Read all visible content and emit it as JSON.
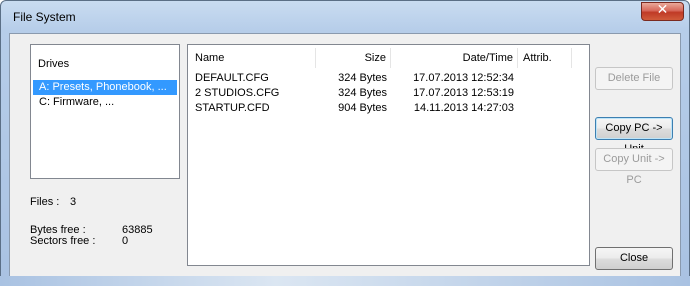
{
  "window": {
    "title": "File System",
    "close_glyph": "✕"
  },
  "drives": {
    "header": "Drives",
    "items": [
      "A: Presets, Phonebook, ...",
      "C: Firmware, ..."
    ]
  },
  "stats": {
    "files_label": "Files :",
    "files_value": "3",
    "bytes_free_label": "Bytes free :",
    "bytes_free_value": "63885",
    "sectors_free_label": "Sectors free :",
    "sectors_free_value": "0"
  },
  "files": {
    "columns": [
      "Name",
      "Size",
      "Date/Time",
      "Attrib."
    ],
    "rows": [
      {
        "name": "DEFAULT.CFG",
        "size": "324 Bytes",
        "datetime": "17.07.2013 12:52:34",
        "attrib": ""
      },
      {
        "name": "2 STUDIOS.CFG",
        "size": "324 Bytes",
        "datetime": "17.07.2013 12:53:19",
        "attrib": ""
      },
      {
        "name": "STARTUP.CFD",
        "size": "904 Bytes",
        "datetime": "14.11.2013 14:27:03",
        "attrib": ""
      }
    ]
  },
  "buttons": {
    "delete_file": "Delete File",
    "copy_pc_to_unit": "Copy PC -> Unit",
    "copy_unit_to_pc": "Copy Unit -> PC",
    "close": "Close"
  }
}
